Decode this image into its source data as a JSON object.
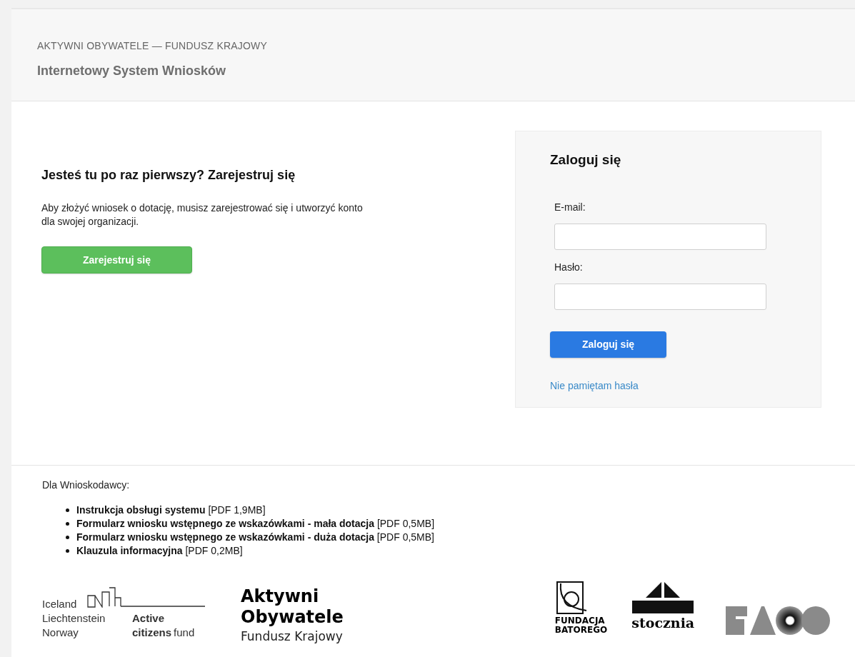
{
  "header": {
    "overline": "AKTYWNI OBYWATELE — FUNDUSZ KRAJOWY",
    "title": "Internetowy System Wniosków"
  },
  "register": {
    "heading": "Jesteś tu po raz pierwszy? Zarejestruj się",
    "text": "Aby złożyć wniosek o dotację, musisz zarejestrować się i utworzyć konto dla swojej organizacji.",
    "button": "Zarejestruj się"
  },
  "login": {
    "heading": "Zaloguj się",
    "fields": [
      {
        "label": "E-mail:"
      },
      {
        "label": "Hasło:"
      }
    ],
    "button": "Zaloguj się",
    "link": "Nie pamiętam hasła"
  },
  "footer": {
    "heading": "Dla Wnioskodawcy:",
    "documents": [
      "**Instrukcja obsługi systemu** [PDF 1,9MB]",
      "**Formularz wniosku wstępnego ze wskazówkami - mała dotacja** [PDF 0,5MB]",
      "**Formularz wniosku wstępnego ze wskazówkami - duża dotacja** [PDF 0,5MB]",
      "**Klauzula informacyjna** [PDF 0,2MB]"
    ],
    "logos": [
      {
        "kind": "eea",
        "countries": [
          "Iceland",
          "Liechtenstein",
          "Norway"
        ],
        "lines": [
          "Active",
          "citizens",
          "fund"
        ]
      },
      {
        "kind": "ao",
        "lines": [
          "Aktywni",
          "Obywatele",
          "Fundusz Krajowy"
        ]
      },
      {
        "kind": "batory",
        "lines": [
          "FUNDACJA",
          "BATOREGO"
        ]
      },
      {
        "kind": "stocznia",
        "lines": [
          "stocznia"
        ]
      },
      {
        "kind": "shapes"
      }
    ]
  }
}
